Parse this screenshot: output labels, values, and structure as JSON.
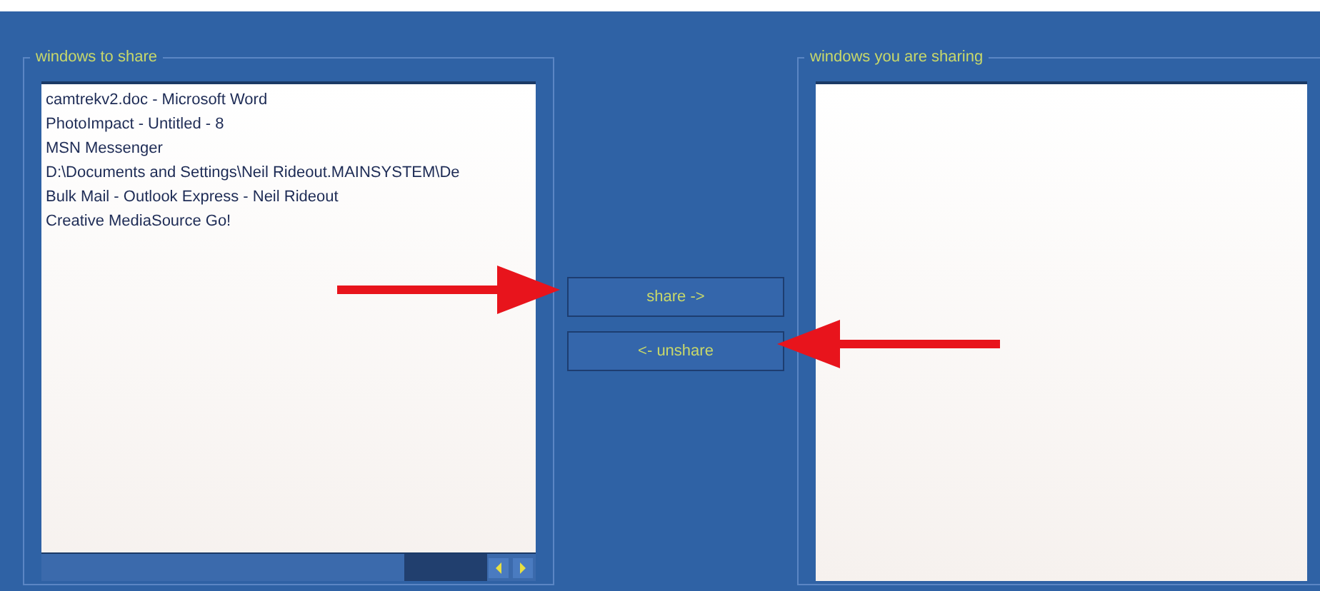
{
  "windows_to_share": {
    "title": "windows to share",
    "items": [
      "camtrekv2.doc - Microsoft Word",
      "PhotoImpact - Untitled - 8",
      "MSN Messenger",
      "D:\\Documents and Settings\\Neil Rideout.MAINSYSTEM\\De",
      "Bulk Mail - Outlook Express - Neil Rideout",
      "Creative MediaSource Go!"
    ]
  },
  "buttons": [
    "share ->",
    "<- unshare"
  ],
  "windows_you_are_sharing": {
    "title": "windows you are sharing"
  }
}
